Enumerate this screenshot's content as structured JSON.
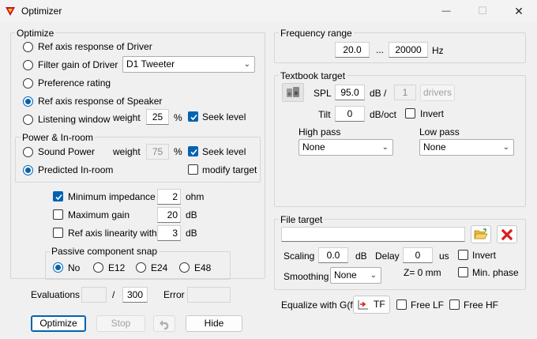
{
  "window": {
    "title": "Optimizer",
    "minimize_glyph": "—",
    "maximize_glyph": "☐",
    "close_glyph": "✕"
  },
  "optimize": {
    "group_label": "Optimize",
    "options": [
      {
        "label": "Ref axis response of Driver",
        "selected": false
      },
      {
        "label": "Filter gain of Driver",
        "selected": false
      },
      {
        "label": "Preference rating",
        "selected": false
      },
      {
        "label": "Ref axis response of Speaker",
        "selected": true
      },
      {
        "label": "Listening window",
        "selected": false
      }
    ],
    "driver_select": "D1 Tweeter",
    "weight_label": "weight",
    "listening_weight": "25",
    "percent": "%",
    "seek_level_label": "Seek level",
    "seek_level_checked": true
  },
  "power": {
    "group_label": "Power & In-room",
    "options": [
      {
        "label": "Sound Power",
        "selected": false
      },
      {
        "label": "Predicted In-room",
        "selected": true
      }
    ],
    "weight_label": "weight",
    "weight": "75",
    "percent": "%",
    "seek_level_label": "Seek level",
    "seek_level_checked": true,
    "modify_target_label": "modify target",
    "modify_target_checked": false
  },
  "constraints": {
    "min_impedance_label": "Minimum impedance",
    "min_impedance_checked": true,
    "min_impedance_value": "2",
    "min_impedance_unit": "ohm",
    "max_gain_label": "Maximum gain",
    "max_gain_checked": false,
    "max_gain_value": "20",
    "max_gain_unit": "dB",
    "linearity_label": "Ref axis linearity within",
    "linearity_checked": false,
    "linearity_value": "3",
    "linearity_unit": "dB"
  },
  "snap": {
    "group_label": "Passive component snap",
    "options": [
      {
        "label": "No",
        "selected": true
      },
      {
        "label": "E12",
        "selected": false
      },
      {
        "label": "E24",
        "selected": false
      },
      {
        "label": "E48",
        "selected": false
      }
    ]
  },
  "evaluations": {
    "label": "Evaluations",
    "current": "",
    "separator": "/",
    "max": "300",
    "error_label": "Error",
    "error_value": ""
  },
  "buttons": {
    "optimize": "Optimize",
    "stop": "Stop",
    "undo_icon": "undo-arrow",
    "hide": "Hide"
  },
  "frequency": {
    "group_label": "Frequency range",
    "low": "20.0",
    "separator": "...",
    "high": "20000",
    "unit": "Hz"
  },
  "textbook": {
    "group_label": "Textbook target",
    "spl_label": "SPL",
    "spl_value": "95.0",
    "spl_unit": "dB /",
    "drivers_count": "1",
    "drivers_label": "drivers",
    "tilt_label": "Tilt",
    "tilt_value": "0",
    "tilt_unit": "dB/oct",
    "invert_label": "Invert",
    "invert_checked": false,
    "high_pass_label": "High pass",
    "high_pass_value": "None",
    "low_pass_label": "Low pass",
    "low_pass_value": "None"
  },
  "file_target": {
    "group_label": "File target",
    "path": "",
    "scaling_label": "Scaling",
    "scaling_value": "0.0",
    "scaling_unit": "dB",
    "delay_label": "Delay",
    "delay_value": "0",
    "delay_unit": "us",
    "invert_label": "Invert",
    "invert_checked": false,
    "smoothing_label": "Smoothing",
    "smoothing_value": "None",
    "z_label": "Z= 0 mm",
    "min_phase_label": "Min. phase",
    "min_phase_checked": false
  },
  "equalize": {
    "label": "Equalize with G(f)",
    "tf_label": "TF",
    "free_lf_label": "Free LF",
    "free_lf_checked": false,
    "free_hf_label": "Free HF",
    "free_hf_checked": false
  },
  "colors": {
    "accent": "#0063b1",
    "app_icon_red": "#c8102e",
    "delete_red": "#d81e1e",
    "folder_yellow": "#e8b830"
  }
}
